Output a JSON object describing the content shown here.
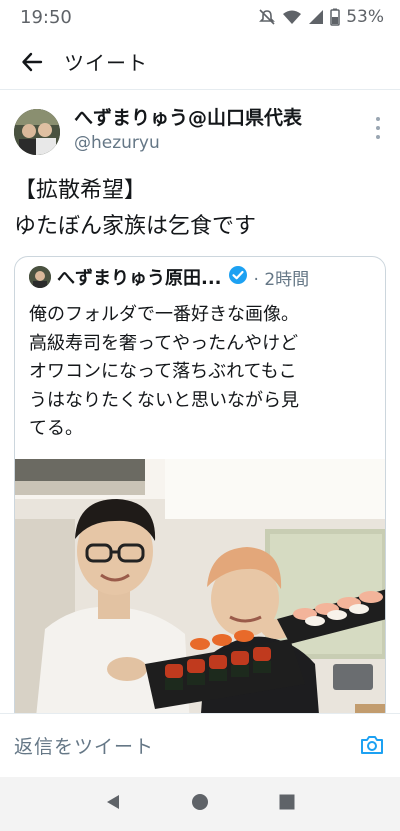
{
  "status_bar": {
    "time": "19:50",
    "battery": "53%"
  },
  "header": {
    "title": "ツイート"
  },
  "tweet": {
    "author_name": "へずまりゅう@山口県代表",
    "author_handle": "@hezuryu",
    "lines": [
      "【拡散希望】",
      "ゆたぼん家族は乞食です"
    ]
  },
  "quote": {
    "author_name": "へずまりゅう原田...",
    "time": "2時間",
    "lines": [
      "俺のフォルダで一番好きな画像。",
      "高級寿司を奢ってやったんやけど",
      "オワコンになって落ちぶれてもこ",
      "うはなりたくないと思いながら見",
      "てる。"
    ]
  },
  "reply": {
    "placeholder": "返信をツイート"
  },
  "colors": {
    "accent": "#1da1f2",
    "text": "#14171a",
    "secondary": "#657786",
    "border": "#e6ecf0"
  }
}
